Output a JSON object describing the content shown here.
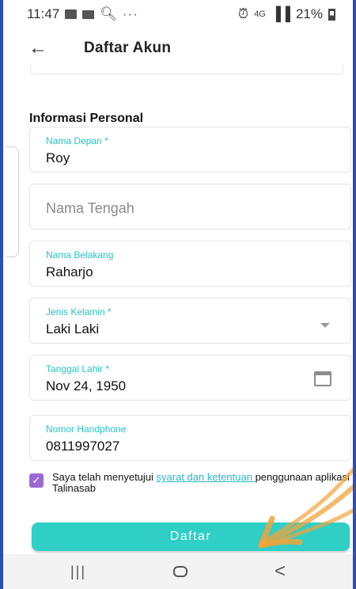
{
  "status_bar": {
    "time": "11:47",
    "overflow": "···",
    "network": "4G",
    "battery": "21%"
  },
  "app_bar": {
    "title": "Daftar Akun"
  },
  "section": {
    "title": "Informasi Personal"
  },
  "fields": {
    "first_name": {
      "label": "Nama Depan *",
      "value": "Roy"
    },
    "middle_name": {
      "placeholder": "Nama Tengah"
    },
    "last_name": {
      "label": "Nama Belakang",
      "value": "Raharjo"
    },
    "gender": {
      "label": "Jenis Kelamin *",
      "value": "Laki Laki"
    },
    "birth_date": {
      "label": "Tanggal Lahir *",
      "value": "Nov 24, 1950"
    },
    "phone": {
      "label": "Nomor Handphone",
      "value": "0811997027"
    }
  },
  "consent": {
    "checked": true,
    "text_before": "Saya telah menyetujui ",
    "link_text": "syarat dan ketentuan ",
    "text_after": "penggunaan aplikasi Talinasab"
  },
  "submit": {
    "label": "Daftar"
  },
  "nav_bar": {
    "recent": "|||",
    "back": "<"
  },
  "colors": {
    "accent": "#2fcfc6",
    "label": "#26c3c6",
    "checkbox": "#9b6ad1",
    "annotation": "#f2a33a"
  }
}
